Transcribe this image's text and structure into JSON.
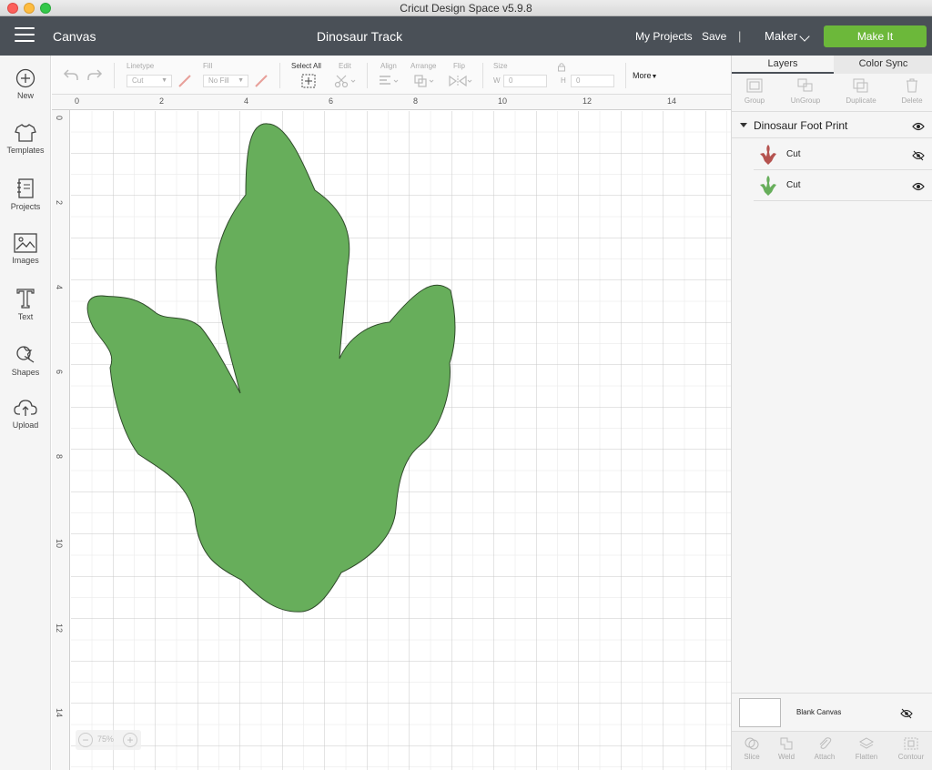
{
  "window": {
    "title": "Cricut Design Space  v5.9.8"
  },
  "header": {
    "section": "Canvas",
    "project_name": "Dinosaur Track",
    "my_projects": "My Projects",
    "save": "Save",
    "separator": "|",
    "machine": "Maker",
    "make_it": "Make It",
    "accent_color": "#6cb83a",
    "bar_color": "#4a5057"
  },
  "left_toolbar": {
    "items": [
      {
        "label": "New",
        "icon": "plus-circle-icon"
      },
      {
        "label": "Templates",
        "icon": "tshirt-icon"
      },
      {
        "label": "Projects",
        "icon": "notebook-icon"
      },
      {
        "label": "Images",
        "icon": "image-icon"
      },
      {
        "label": "Text",
        "icon": "text-t-icon"
      },
      {
        "label": "Shapes",
        "icon": "shapes-icon"
      },
      {
        "label": "Upload",
        "icon": "cloud-upload-icon"
      }
    ]
  },
  "edit_toolbar": {
    "linetype_label": "Linetype",
    "linetype_value": "Cut",
    "fill_label": "Fill",
    "fill_value": "No Fill",
    "select_all": "Select All",
    "edit_label": "Edit",
    "align_label": "Align",
    "arrange_label": "Arrange",
    "flip_label": "Flip",
    "size_label": "Size",
    "w_label": "W",
    "w_value": "0",
    "h_label": "H",
    "h_value": "0",
    "more": "More"
  },
  "canvas": {
    "ruler_top": [
      "0",
      "2",
      "4",
      "6",
      "8",
      "10",
      "12",
      "14"
    ],
    "ruler_left": [
      "0",
      "2",
      "4",
      "6",
      "8",
      "10",
      "12",
      "14"
    ],
    "shape_color": "#67ae5b",
    "zoom": "75%",
    "zoom_minus": "−",
    "zoom_plus": "+"
  },
  "right_panel": {
    "tabs": {
      "layers": "Layers",
      "color_sync": "Color Sync"
    },
    "layer_tools": [
      "Group",
      "UnGroup",
      "Duplicate",
      "Delete"
    ],
    "group": {
      "name": "Dinosaur Foot Print",
      "layers": [
        {
          "name": "Cut",
          "color": "#b5534f",
          "visible": false
        },
        {
          "name": "Cut",
          "color": "#67ae5b",
          "visible": true
        }
      ]
    },
    "blank_canvas": "Blank Canvas",
    "bottom_tools": [
      "Slice",
      "Weld",
      "Attach",
      "Flatten",
      "Contour"
    ]
  }
}
